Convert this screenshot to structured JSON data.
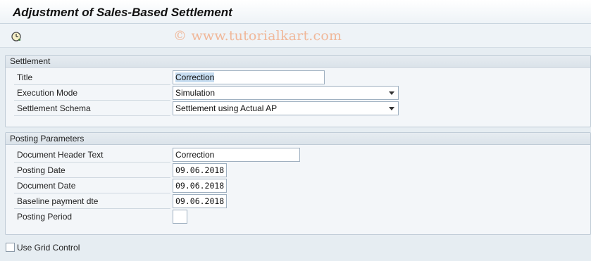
{
  "page": {
    "title": "Adjustment of Sales-Based Settlement"
  },
  "toolbar": {
    "execute_icon": "execute-clock-icon"
  },
  "watermark": "© www.tutorialkart.com",
  "settlement": {
    "header": "Settlement",
    "title_label": "Title",
    "title_value": "Correction",
    "execution_mode_label": "Execution Mode",
    "execution_mode_value": "Simulation",
    "schema_label": "Settlement Schema",
    "schema_value": "Settlement using Actual AP"
  },
  "posting": {
    "header": "Posting Parameters",
    "doc_header_text_label": "Document Header Text",
    "doc_header_text_value": "Correction",
    "posting_date_label": "Posting Date",
    "posting_date_value": "09.06.2018",
    "document_date_label": "Document Date",
    "document_date_value": "09.06.2018",
    "baseline_label": "Baseline payment dte",
    "baseline_value": "09.06.2018",
    "posting_period_label": "Posting Period",
    "posting_period_value": ""
  },
  "options": {
    "grid_control_label": "Use Grid Control",
    "grid_control_checked": false
  }
}
